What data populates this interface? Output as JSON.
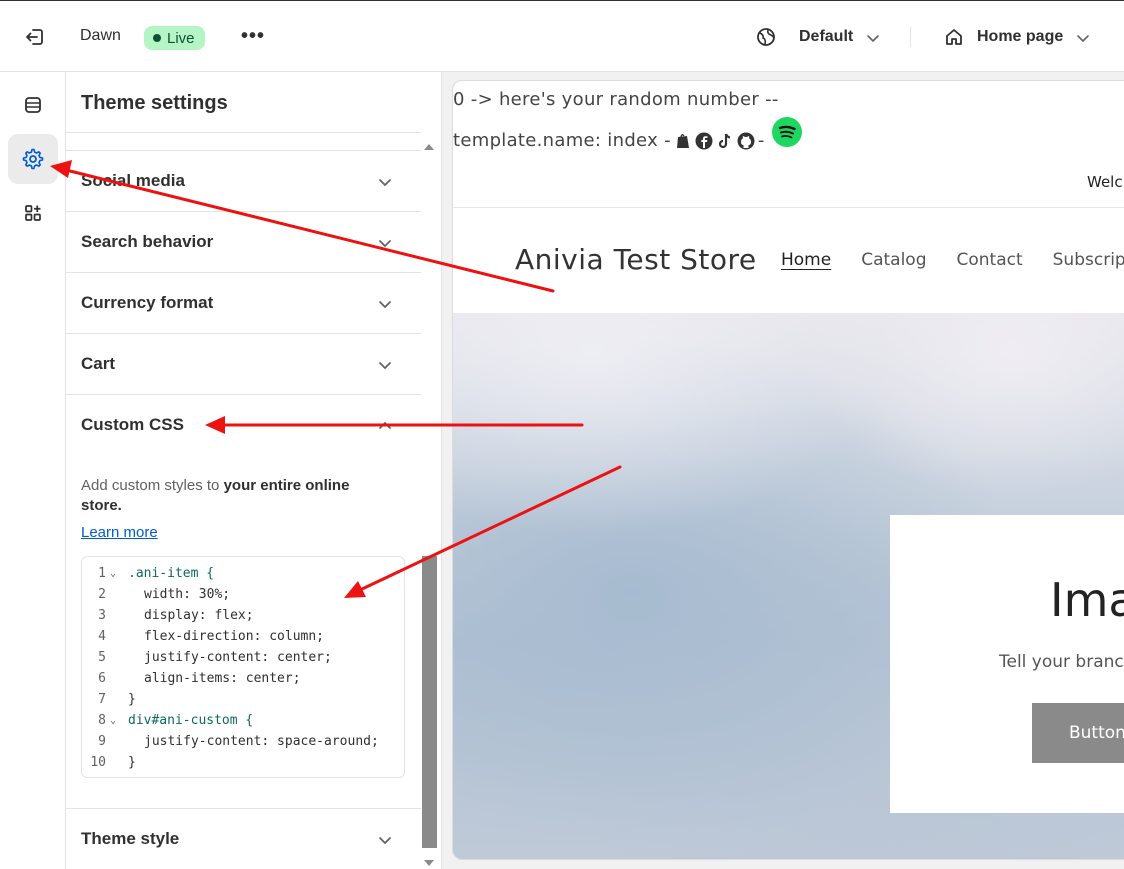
{
  "topbar": {
    "theme_name": "Dawn",
    "status": "Live",
    "more": "•••",
    "locale": "Default",
    "template": "Home page"
  },
  "sidebar": {
    "title": "Theme settings",
    "sections": [
      "Social media",
      "Search behavior",
      "Currency format",
      "Cart",
      "Custom CSS"
    ],
    "custom_css": {
      "description_prefix": "Add custom styles to ",
      "description_bold": "your entire online store.",
      "learn_more": "Learn more",
      "code": [
        {
          "n": "1",
          "fold": true,
          "text": ".ani-item {"
        },
        {
          "n": "2",
          "fold": false,
          "text": "width: 30%;"
        },
        {
          "n": "3",
          "fold": false,
          "text": "display: flex;"
        },
        {
          "n": "4",
          "fold": false,
          "text": "flex-direction: column;"
        },
        {
          "n": "5",
          "fold": false,
          "text": "justify-content: center;"
        },
        {
          "n": "6",
          "fold": false,
          "text": "align-items: center;"
        },
        {
          "n": "7",
          "fold": false,
          "text": "}"
        },
        {
          "n": "8",
          "fold": true,
          "text": "div#ani-custom {"
        },
        {
          "n": "9",
          "fold": false,
          "text": "justify-content: space-around;"
        },
        {
          "n": "10",
          "fold": false,
          "text": "}"
        }
      ]
    },
    "last_section": "Theme style"
  },
  "preview": {
    "debug_line1": "0 -> here's your random number --",
    "debug_line2_prefix": "template.name: index -",
    "debug_line2_suffix": "-",
    "announcement": "Welc",
    "store_name": "Anivia Test Store",
    "nav": [
      "Home",
      "Catalog",
      "Contact",
      "Subscriptio"
    ],
    "hero_title": "Ima",
    "hero_subtitle": "Tell your branc",
    "hero_button": "Button"
  },
  "colors": {
    "live_badge": "#b5f5c5",
    "link": "#005bd3",
    "annotation_arrow": "#ee1111",
    "spotify": "#1ed760"
  }
}
